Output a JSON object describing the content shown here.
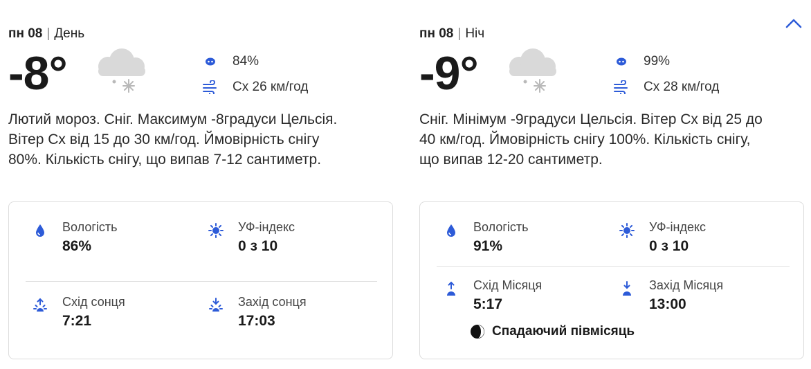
{
  "colors": {
    "accent": "#2d5bd8",
    "cloud": "#d9d9d9",
    "snowflake": "#b9b9b9",
    "border": "#dcdcdc"
  },
  "day": {
    "date": "пн 08",
    "period": "День",
    "temp": "-8°",
    "weather_icon": "cloud-snow-icon",
    "precip_pct": "84%",
    "wind": "Сх 26 км/год",
    "description": "Лютий мороз. Сніг. Максимум -8градуси Цельсія. Вітер Сх від 15 до 30 км/год. Ймовірність снігу 80%. Кількість снігу, що випав 7-12 сантиметр.",
    "humidity_label": "Вологість",
    "humidity_value": "86%",
    "uv_label": "УФ-індекс",
    "uv_value": "0 з 10",
    "sunrise_label": "Схід сонця",
    "sunrise_value": "7:21",
    "sunset_label": "Захід сонця",
    "sunset_value": "17:03"
  },
  "night": {
    "date": "пн 08",
    "period": "Ніч",
    "temp": "-9°",
    "weather_icon": "cloud-snow-icon",
    "precip_pct": "99%",
    "wind": "Сх 28 км/год",
    "description": "Сніг. Мінімум -9градуси Цельсія. Вітер Сх від 25 до 40 км/год. Ймовірність снігу 100%. Кількість снігу, що випав 12-20 сантиметр.",
    "humidity_label": "Вологість",
    "humidity_value": "91%",
    "uv_label": "УФ-індекс",
    "uv_value": "0 з 10",
    "moonrise_label": "Схід Місяця",
    "moonrise_value": "5:17",
    "moonset_label": "Захід Місяця",
    "moonset_value": "13:00",
    "moon_phase": "Спадаючий півмісяць"
  }
}
